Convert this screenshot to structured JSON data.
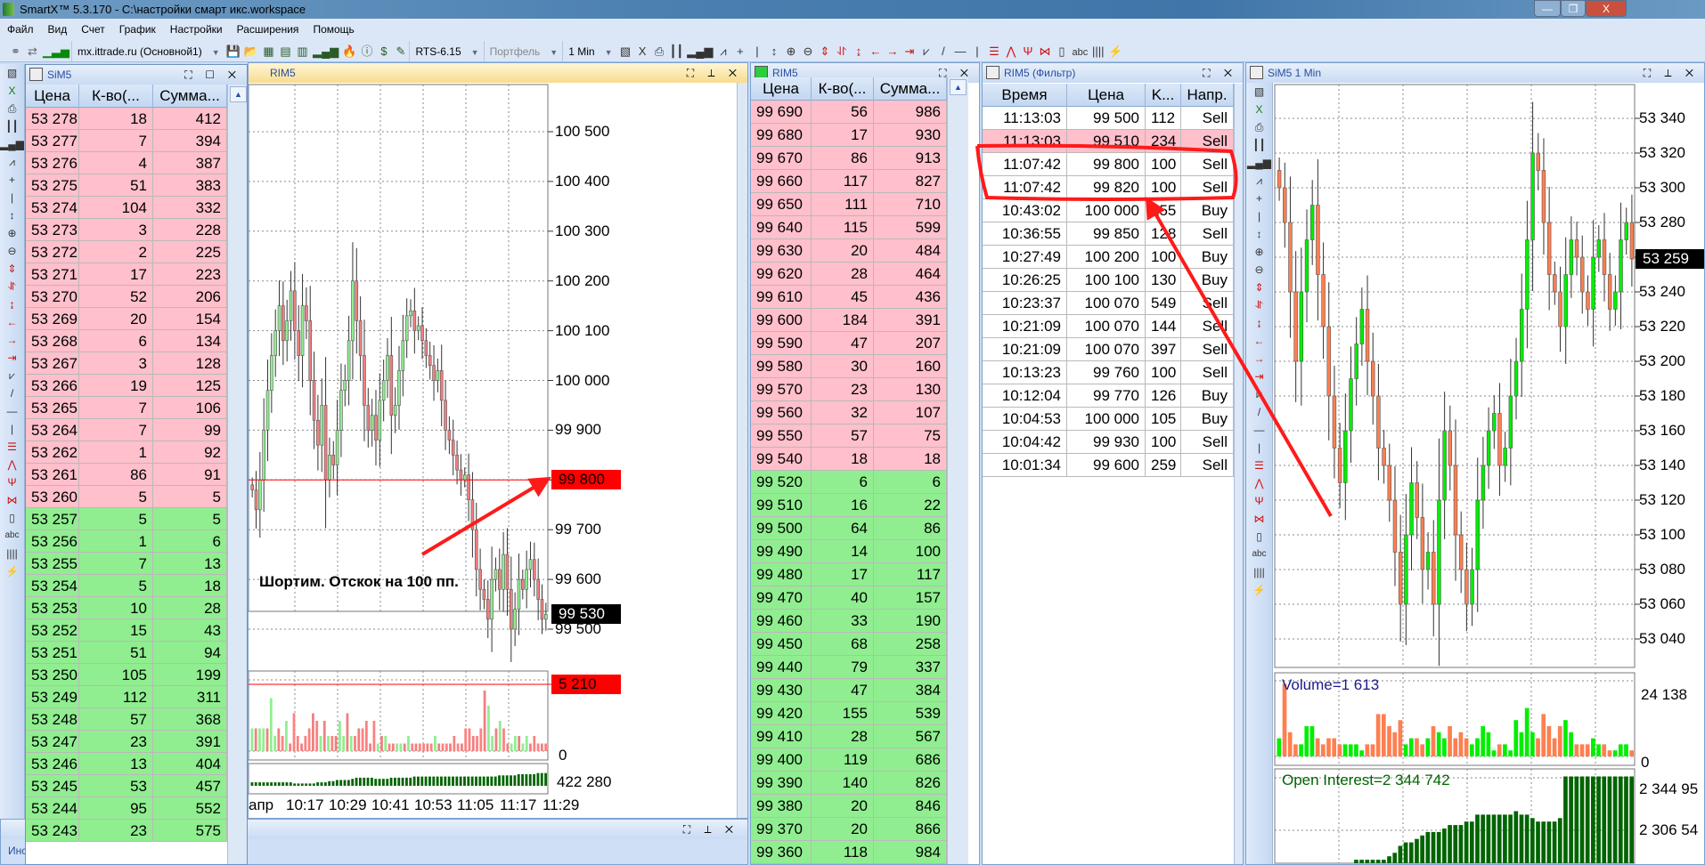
{
  "window": {
    "title": "SmartX™ 5.3.170 - C:\\настройки смарт икс.workspace",
    "min": "—",
    "max": "❐",
    "close": "X"
  },
  "menu": [
    "Файл",
    "Вид",
    "Счет",
    "График",
    "Настройки",
    "Расширения",
    "Помощь"
  ],
  "toolbar": {
    "connection": "mx.ittrade.ru (Основной1)",
    "instrument": "RTS-6.15",
    "portfolio": "Портфель",
    "timeframe": "1 Min",
    "icons": [
      "link-icon",
      "disconnect-icon",
      "signal-icon",
      "save-icon",
      "open-folder-icon",
      "grid-icon",
      "orderbook-icon",
      "orderbook-red-icon",
      "bars-icon",
      "fire-icon",
      "info-icon",
      "dollar-icon",
      "notepad-icon"
    ],
    "icons2": [
      "chart-settings-icon",
      "excel-icon",
      "print-icon",
      "candles-icon",
      "bars-icon",
      "line-chart-icon",
      "crosshair-icon",
      "vertical-line-icon",
      "cursor-icon",
      "zoom-in-icon",
      "zoom-out-icon",
      "expand-vertical-icon",
      "compress-vertical-icon",
      "fit-vertical-icon",
      "scroll-left-icon",
      "scroll-right-icon",
      "scroll-end-icon",
      "polyline-icon",
      "trendline-icon",
      "horizontal-line-icon",
      "vertical-line-icon",
      "fibo-levels-icon",
      "fibo-fan-icon",
      "fibo-arcs-icon",
      "fibo-time-icon",
      "rectangle-icon",
      "text-icon",
      "cycles-icon",
      "order-line-icon"
    ],
    "glyphs": {
      "link-icon": "⚭",
      "disconnect-icon": "⇄",
      "signal-icon": "▁▃▅",
      "save-icon": "💾",
      "open-folder-icon": "📂",
      "grid-icon": "▦",
      "orderbook-icon": "▤",
      "orderbook-red-icon": "▥",
      "bars-icon": "▂▄▆",
      "fire-icon": "🔥",
      "info-icon": "ⓘ",
      "dollar-icon": "$",
      "notepad-icon": "✎",
      "chart-settings-icon": "▧",
      "excel-icon": "X",
      "print-icon": "⎙",
      "candles-icon": "┃┃",
      "line-chart-icon": "⩘",
      "crosshair-icon": "+",
      "vertical-line-icon": "|",
      "cursor-icon": "↕",
      "zoom-in-icon": "⊕",
      "zoom-out-icon": "⊖",
      "expand-vertical-icon": "⇕",
      "compress-vertical-icon": "⥯",
      "fit-vertical-icon": "↨",
      "scroll-left-icon": "←",
      "scroll-right-icon": "→",
      "scroll-end-icon": "⇥",
      "polyline-icon": "⩗",
      "trendline-icon": "/",
      "horizontal-line-icon": "—",
      "fibo-levels-icon": "☰",
      "fibo-fan-icon": "⋀",
      "fibo-arcs-icon": "Ψ",
      "fibo-time-icon": "⋈",
      "rectangle-icon": "▯",
      "text-icon": "abc",
      "cycles-icon": "||||",
      "order-line-icon": "⚡"
    }
  },
  "sim5_book": {
    "title": "SiM5",
    "columns": [
      "Цена",
      "К-во(...",
      "Сумма..."
    ],
    "asks": [
      [
        "53 278",
        "18",
        "412"
      ],
      [
        "53 277",
        "7",
        "394"
      ],
      [
        "53 276",
        "4",
        "387"
      ],
      [
        "53 275",
        "51",
        "383"
      ],
      [
        "53 274",
        "104",
        "332"
      ],
      [
        "53 273",
        "3",
        "228"
      ],
      [
        "53 272",
        "2",
        "225"
      ],
      [
        "53 271",
        "17",
        "223"
      ],
      [
        "53 270",
        "52",
        "206"
      ],
      [
        "53 269",
        "20",
        "154"
      ],
      [
        "53 268",
        "6",
        "134"
      ],
      [
        "53 267",
        "3",
        "128"
      ],
      [
        "53 266",
        "19",
        "125"
      ],
      [
        "53 265",
        "7",
        "106"
      ],
      [
        "53 264",
        "7",
        "99"
      ],
      [
        "53 262",
        "1",
        "92"
      ],
      [
        "53 261",
        "86",
        "91"
      ],
      [
        "53 260",
        "5",
        "5"
      ]
    ],
    "bids": [
      [
        "53 257",
        "5",
        "5"
      ],
      [
        "53 256",
        "1",
        "6"
      ],
      [
        "53 255",
        "7",
        "13"
      ],
      [
        "53 254",
        "5",
        "18"
      ],
      [
        "53 253",
        "10",
        "28"
      ],
      [
        "53 252",
        "15",
        "43"
      ],
      [
        "53 251",
        "51",
        "94"
      ],
      [
        "53 250",
        "105",
        "199"
      ],
      [
        "53 249",
        "112",
        "311"
      ],
      [
        "53 248",
        "57",
        "368"
      ],
      [
        "53 247",
        "23",
        "391"
      ],
      [
        "53 246",
        "13",
        "404"
      ],
      [
        "53 245",
        "53",
        "457"
      ],
      [
        "53 244",
        "95",
        "552"
      ],
      [
        "53 243",
        "23",
        "575"
      ]
    ]
  },
  "rim5_chart": {
    "title": "RIM5",
    "price_ticks": [
      "100 500",
      "100 400",
      "100 300",
      "100 200",
      "100 100",
      "100 000",
      "99 900",
      "99 800",
      "99 700",
      "99 600",
      "99 500"
    ],
    "tick_values": [
      100500,
      100400,
      100300,
      100200,
      100100,
      100000,
      99900,
      99800,
      99700,
      99600,
      99500
    ],
    "level_tag": "99 800",
    "level_value": 99800,
    "last_tag": "99 530",
    "last_value": 99530,
    "volume_tag": "5 210",
    "volume_zero": "0",
    "oi_tag": "422 280",
    "time_ticks": [
      "апр",
      "10:17",
      "10:29",
      "10:41",
      "10:53",
      "11:05",
      "11:17",
      "11:29"
    ],
    "annotation": "Шортим. Отскок на 100 пп.",
    "closes": [
      99780,
      99740,
      99800,
      99900,
      99980,
      100050,
      100100,
      100150,
      100080,
      100120,
      100180,
      100100,
      100050,
      100150,
      100120,
      100000,
      99920,
      99870,
      99950,
      99800,
      99850,
      99830,
      99900,
      99980,
      100000,
      100080,
      100200,
      100120,
      100050,
      99950,
      99900,
      99930,
      99880,
      99960,
      100000,
      100050,
      99930,
      99950,
      100020,
      100080,
      100130,
      100140,
      100100,
      100110,
      100080,
      100050,
      100030,
      100000,
      100020,
      99960,
      99900,
      99880,
      99850,
      99820,
      99800,
      99810,
      99760,
      99700,
      99620,
      99580,
      99560,
      99520,
      99600,
      99620,
      99580,
      99650,
      99580,
      99500,
      99540,
      99600,
      99580,
      99620,
      99640,
      99600,
      99560,
      99520,
      99530
    ],
    "volumes": [
      3,
      3,
      3,
      3,
      3,
      7,
      2,
      3,
      2,
      4,
      1,
      5,
      2,
      1,
      2,
      3,
      5,
      4,
      2,
      4,
      2,
      2,
      2,
      4,
      2,
      5,
      2,
      2,
      3,
      3,
      4,
      1,
      4,
      1,
      2,
      2,
      1,
      1,
      1,
      1,
      1,
      2,
      1,
      1,
      1,
      1,
      1,
      1,
      2,
      1,
      1,
      1,
      1,
      2,
      1,
      1,
      3,
      3,
      2,
      2,
      3,
      8,
      6,
      2,
      3,
      4,
      3,
      1,
      1,
      2,
      2,
      1,
      2,
      1,
      2,
      1,
      1,
      1
    ],
    "oi": [
      3,
      3,
      3,
      3,
      3,
      3,
      3,
      3,
      3,
      3,
      3,
      2,
      2,
      2,
      2,
      2,
      2,
      3,
      3,
      3,
      4,
      4,
      5,
      5,
      5,
      5,
      6,
      7,
      7,
      7,
      7,
      7,
      6,
      6,
      6,
      6,
      7,
      7,
      7,
      7,
      7,
      7,
      8,
      8,
      8,
      8,
      8,
      8,
      8,
      8,
      8,
      8,
      8,
      8,
      8,
      8,
      8,
      8,
      8,
      8,
      8,
      8,
      8,
      8,
      9,
      9,
      9,
      9,
      9,
      10,
      10,
      10,
      10,
      10,
      11,
      11,
      11
    ]
  },
  "rim5_book": {
    "title": "RIM5",
    "columns": [
      "Цена",
      "К-во(...",
      "Сумма..."
    ],
    "asks": [
      [
        "99 690",
        "56",
        "986"
      ],
      [
        "99 680",
        "17",
        "930"
      ],
      [
        "99 670",
        "86",
        "913"
      ],
      [
        "99 660",
        "117",
        "827"
      ],
      [
        "99 650",
        "111",
        "710"
      ],
      [
        "99 640",
        "115",
        "599"
      ],
      [
        "99 630",
        "20",
        "484"
      ],
      [
        "99 620",
        "28",
        "464"
      ],
      [
        "99 610",
        "45",
        "436"
      ],
      [
        "99 600",
        "184",
        "391"
      ],
      [
        "99 590",
        "47",
        "207"
      ],
      [
        "99 580",
        "30",
        "160"
      ],
      [
        "99 570",
        "23",
        "130"
      ],
      [
        "99 560",
        "32",
        "107"
      ],
      [
        "99 550",
        "57",
        "75"
      ],
      [
        "99 540",
        "18",
        "18"
      ]
    ],
    "bids": [
      [
        "99 520",
        "6",
        "6"
      ],
      [
        "99 510",
        "16",
        "22"
      ],
      [
        "99 500",
        "64",
        "86"
      ],
      [
        "99 490",
        "14",
        "100"
      ],
      [
        "99 480",
        "17",
        "117"
      ],
      [
        "99 470",
        "40",
        "157"
      ],
      [
        "99 460",
        "33",
        "190"
      ],
      [
        "99 450",
        "68",
        "258"
      ],
      [
        "99 440",
        "79",
        "337"
      ],
      [
        "99 430",
        "47",
        "384"
      ],
      [
        "99 420",
        "155",
        "539"
      ],
      [
        "99 410",
        "28",
        "567"
      ],
      [
        "99 400",
        "119",
        "686"
      ],
      [
        "99 390",
        "140",
        "826"
      ],
      [
        "99 380",
        "20",
        "846"
      ],
      [
        "99 370",
        "20",
        "866"
      ],
      [
        "99 360",
        "118",
        "984"
      ]
    ]
  },
  "trades": {
    "title": "RIM5 (Фильтр)",
    "columns": [
      "Время",
      "Цена",
      "K...",
      "Напр."
    ],
    "rows": [
      [
        "11:13:03",
        "99 500",
        "112",
        "Sell"
      ],
      [
        "11:13:03",
        "99 510",
        "234",
        "Sell"
      ],
      [
        "11:07:42",
        "99 800",
        "100",
        "Sell"
      ],
      [
        "11:07:42",
        "99 820",
        "100",
        "Sell"
      ],
      [
        "10:43:02",
        "100 000",
        "155",
        "Buy"
      ],
      [
        "10:36:55",
        "99 850",
        "128",
        "Sell"
      ],
      [
        "10:27:49",
        "100 200",
        "100",
        "Buy"
      ],
      [
        "10:26:25",
        "100 100",
        "130",
        "Buy"
      ],
      [
        "10:23:37",
        "100 070",
        "549",
        "Sell"
      ],
      [
        "10:21:09",
        "100 070",
        "144",
        "Sell"
      ],
      [
        "10:21:09",
        "100 070",
        "397",
        "Sell"
      ],
      [
        "10:13:23",
        "99 760",
        "100",
        "Sell"
      ],
      [
        "10:12:04",
        "99 770",
        "126",
        "Buy"
      ],
      [
        "10:04:53",
        "100 000",
        "105",
        "Buy"
      ],
      [
        "10:04:42",
        "99 930",
        "100",
        "Sell"
      ],
      [
        "10:01:34",
        "99 600",
        "259",
        "Sell"
      ]
    ],
    "highlight": [
      1
    ]
  },
  "sim5_chart": {
    "title": "SiM5 1 Min",
    "price_ticks": [
      "53 340",
      "53 320",
      "53 300",
      "53 280",
      "53 260",
      "53 240",
      "53 220",
      "53 200",
      "53 180",
      "53 160",
      "53 140",
      "53 120",
      "53 100",
      "53 080",
      "53 060",
      "53 040"
    ],
    "tick_values": [
      53340,
      53320,
      53300,
      53280,
      53260,
      53240,
      53220,
      53200,
      53180,
      53160,
      53140,
      53120,
      53100,
      53080,
      53060,
      53040
    ],
    "last_tag": "53 259",
    "last_value": 53259,
    "volume_label": "Volume=1 613",
    "volume_tick": "24 138",
    "volume_zero": "0",
    "oi_label": "Open Interest=2 344 742",
    "oi_ticks": [
      "2 344 95",
      "2 306 54"
    ],
    "closes": [
      53300,
      53280,
      53240,
      53200,
      53240,
      53270,
      53290,
      53250,
      53220,
      53180,
      53150,
      53130,
      53160,
      53190,
      53210,
      53230,
      53200,
      53180,
      53150,
      53140,
      53120,
      53090,
      53060,
      53100,
      53130,
      53110,
      53080,
      53090,
      53060,
      53120,
      53160,
      53140,
      53100,
      53080,
      53060,
      53080,
      53120,
      53140,
      53160,
      53170,
      53140,
      53150,
      53180,
      53200,
      53230,
      53270,
      53320,
      53310,
      53280,
      53250,
      53240,
      53220,
      53250,
      53270,
      53260,
      53240,
      53230,
      53260,
      53270,
      53250,
      53230,
      53240,
      53270,
      53280,
      53259
    ],
    "volumes": [
      3,
      12,
      4,
      2,
      2,
      5,
      5,
      3,
      2,
      3,
      3,
      2,
      2,
      2,
      2,
      1,
      2,
      2,
      7,
      7,
      5,
      4,
      6,
      2,
      3,
      3,
      2,
      3,
      5,
      4,
      3,
      5,
      3,
      4,
      3,
      2,
      3,
      5,
      4,
      1,
      2,
      2,
      1,
      6,
      4,
      8,
      4,
      3,
      7,
      5,
      3,
      5,
      6,
      4,
      2,
      2,
      2,
      3,
      2,
      2,
      1,
      1,
      2,
      2,
      1
    ],
    "oi": [
      0,
      0,
      0,
      0,
      0,
      0,
      0,
      0,
      0,
      0,
      0,
      0,
      0,
      0,
      1,
      1,
      1,
      1,
      1,
      1,
      2,
      3,
      5,
      6,
      6,
      7,
      8,
      9,
      9,
      9,
      10,
      11,
      11,
      11,
      12,
      12,
      14,
      14,
      14,
      14,
      14,
      14,
      14,
      15,
      14,
      14,
      13,
      12,
      12,
      12,
      12,
      13,
      25,
      25,
      25,
      25,
      25,
      25,
      25,
      25,
      25,
      25,
      25,
      25,
      25
    ]
  },
  "bottom_panel": {
    "tab": "Инс"
  },
  "colors": {
    "ask": "#ffc0cb",
    "bid": "#90ee90",
    "red": "#ff0000",
    "candle_up": "#90ee90",
    "candle_down": "#f08080",
    "sim_up": "#00ee00",
    "sim_down": "#ff7f50",
    "oi": "#006400"
  }
}
